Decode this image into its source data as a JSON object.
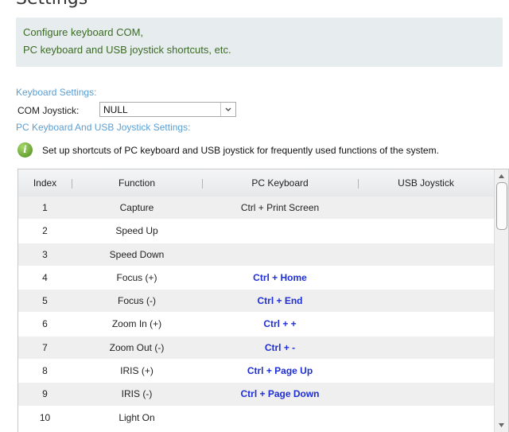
{
  "header": {
    "partial_title": "Settings"
  },
  "info": {
    "line1": "Configure keyboard COM,",
    "line2": "PC keyboard and USB joystick shortcuts, etc."
  },
  "keyboard_settings": {
    "section_title": "Keyboard Settings:",
    "com_label": "COM Joystick:",
    "com_value": "NULL"
  },
  "pc_settings": {
    "section_title": "PC Keyboard And USB Joystick Settings:",
    "hint": "Set up shortcuts of PC keyboard and USB joystick for frequently used functions of the system.",
    "hint_icon": "info-icon"
  },
  "table": {
    "headers": {
      "index": "Index",
      "function": "Function",
      "pc_keyboard": "PC Keyboard",
      "usb_joystick": "USB Joystick"
    },
    "rows": [
      {
        "index": "1",
        "function": "Capture",
        "pc_keyboard": "Ctrl + Print Screen",
        "usb_joystick": "",
        "custom": false
      },
      {
        "index": "2",
        "function": "Speed Up",
        "pc_keyboard": "",
        "usb_joystick": "",
        "custom": false
      },
      {
        "index": "3",
        "function": "Speed Down",
        "pc_keyboard": "",
        "usb_joystick": "",
        "custom": false
      },
      {
        "index": "4",
        "function": "Focus (+)",
        "pc_keyboard": "Ctrl + Home",
        "usb_joystick": "",
        "custom": true
      },
      {
        "index": "5",
        "function": "Focus (-)",
        "pc_keyboard": "Ctrl + End",
        "usb_joystick": "",
        "custom": true
      },
      {
        "index": "6",
        "function": "Zoom In (+)",
        "pc_keyboard": "Ctrl + +",
        "usb_joystick": "",
        "custom": true
      },
      {
        "index": "7",
        "function": "Zoom Out (-)",
        "pc_keyboard": "Ctrl + -",
        "usb_joystick": "",
        "custom": true
      },
      {
        "index": "8",
        "function": "IRIS (+)",
        "pc_keyboard": "Ctrl + Page Up",
        "usb_joystick": "",
        "custom": true
      },
      {
        "index": "9",
        "function": "IRIS (-)",
        "pc_keyboard": "Ctrl + Page Down",
        "usb_joystick": "",
        "custom": true
      },
      {
        "index": "10",
        "function": "Light On",
        "pc_keyboard": "",
        "usb_joystick": "",
        "custom": false
      }
    ]
  },
  "colors": {
    "info_text": "#3b6b24",
    "section_title": "#5a9fd4",
    "custom_shortcut": "#1f2fd6",
    "row_alt": "#efefef"
  }
}
